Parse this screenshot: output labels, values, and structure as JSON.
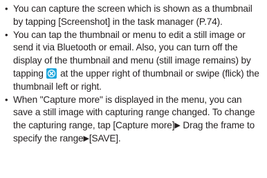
{
  "bullet_symbol": "•",
  "items": [
    {
      "text": "You can capture the screen which is shown as a thumbnail by tapping [Screenshot] in the task manager (P.74)."
    },
    {
      "text_before_icon": "You can tap the thumbnail or menu to edit a still image or send it via Bluetooth or email. Also, you can turn off the display of the thumbnail and menu (still image remains) by tapping",
      "icon": "close-icon",
      "text_after_icon": "at the upper right of thumbnail or swipe (flick) the thumbnail left or right."
    },
    {
      "text_part1": "When \"Capture more\" is displayed in the menu, you can save a still image with capturing range changed. To change the capturing range, tap [Capture more]",
      "arrow_symbol": "▶",
      "text_part2": "Drag the frame to specify the range",
      "text_part3": "[SAVE]."
    }
  ],
  "colors": {
    "text": "#231f20",
    "icon_fill": "#1ba5dc",
    "icon_mark": "#ffffff"
  }
}
